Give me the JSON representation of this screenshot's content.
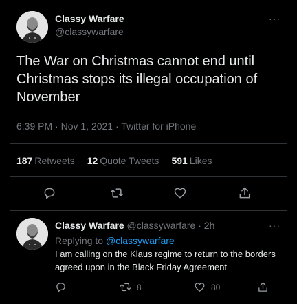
{
  "tweet": {
    "author_name": "Classy Warfare",
    "author_handle": "@classywarfare",
    "more_label": "···",
    "text": "The War on Christmas cannot end until Christmas stops its illegal occupation of November",
    "time": "6:39 PM",
    "date": "Nov 1, 2021",
    "source": "Twitter for iPhone",
    "retweets_count": "187",
    "retweets_label": "Retweets",
    "quotes_count": "12",
    "quotes_label": "Quote Tweets",
    "likes_count": "591",
    "likes_label": "Likes",
    "actions": [
      {
        "icon": "reply-icon"
      },
      {
        "icon": "retweet-icon"
      },
      {
        "icon": "like-icon"
      },
      {
        "icon": "share-icon"
      }
    ]
  },
  "reply": {
    "author_name": "Classy Warfare",
    "author_handle": "@classywarfare",
    "separator": "·",
    "age": "2h",
    "more_label": "···",
    "replying_prefix": "Replying to",
    "replying_mention": "@classywarfare",
    "text": "I am calling on the Klaus regime to return to the borders agreed upon in the Black Friday Agreement",
    "retweets_count": "8",
    "likes_count": "80"
  },
  "colors": {
    "background": "#000000",
    "text_primary": "#e7e9ea",
    "text_secondary": "#71767b",
    "link": "#1d9bf0",
    "divider": "#2f3336"
  }
}
